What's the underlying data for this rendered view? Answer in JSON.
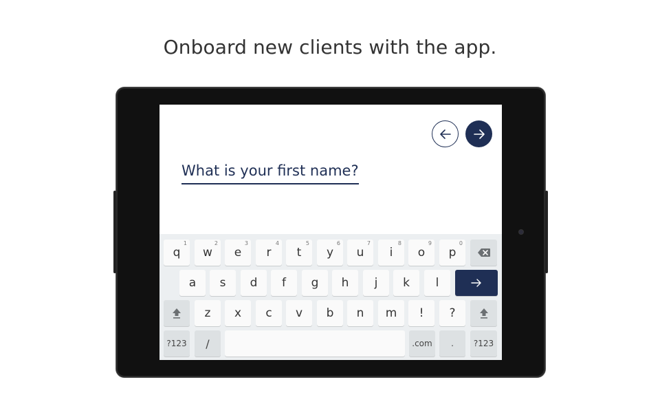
{
  "headline": "Onboard new clients with the app.",
  "form": {
    "question": "What is your first name?"
  },
  "nav": {
    "back_icon": "arrow-left-icon",
    "next_icon": "arrow-right-icon"
  },
  "keyboard": {
    "row1": [
      {
        "label": "q",
        "hint": "1"
      },
      {
        "label": "w",
        "hint": "2"
      },
      {
        "label": "e",
        "hint": "3"
      },
      {
        "label": "r",
        "hint": "4"
      },
      {
        "label": "t",
        "hint": "5"
      },
      {
        "label": "y",
        "hint": "6"
      },
      {
        "label": "u",
        "hint": "7"
      },
      {
        "label": "i",
        "hint": "8"
      },
      {
        "label": "o",
        "hint": "9"
      },
      {
        "label": "p",
        "hint": "0"
      }
    ],
    "row2": [
      "a",
      "s",
      "d",
      "f",
      "g",
      "h",
      "j",
      "k",
      "l"
    ],
    "row3": [
      "z",
      "x",
      "c",
      "v",
      "b",
      "n",
      "m",
      "!",
      "?"
    ],
    "row4": {
      "left_symbols": "?123",
      "slash": "/",
      "dotcom": ".com",
      "period": ".",
      "right_symbols": "?123"
    },
    "icons": {
      "backspace": "backspace-icon",
      "enter": "arrow-right-icon",
      "shift": "shift-icon"
    }
  },
  "colors": {
    "brand": "#1f2f55",
    "keyboard_bg": "#eceff1"
  }
}
